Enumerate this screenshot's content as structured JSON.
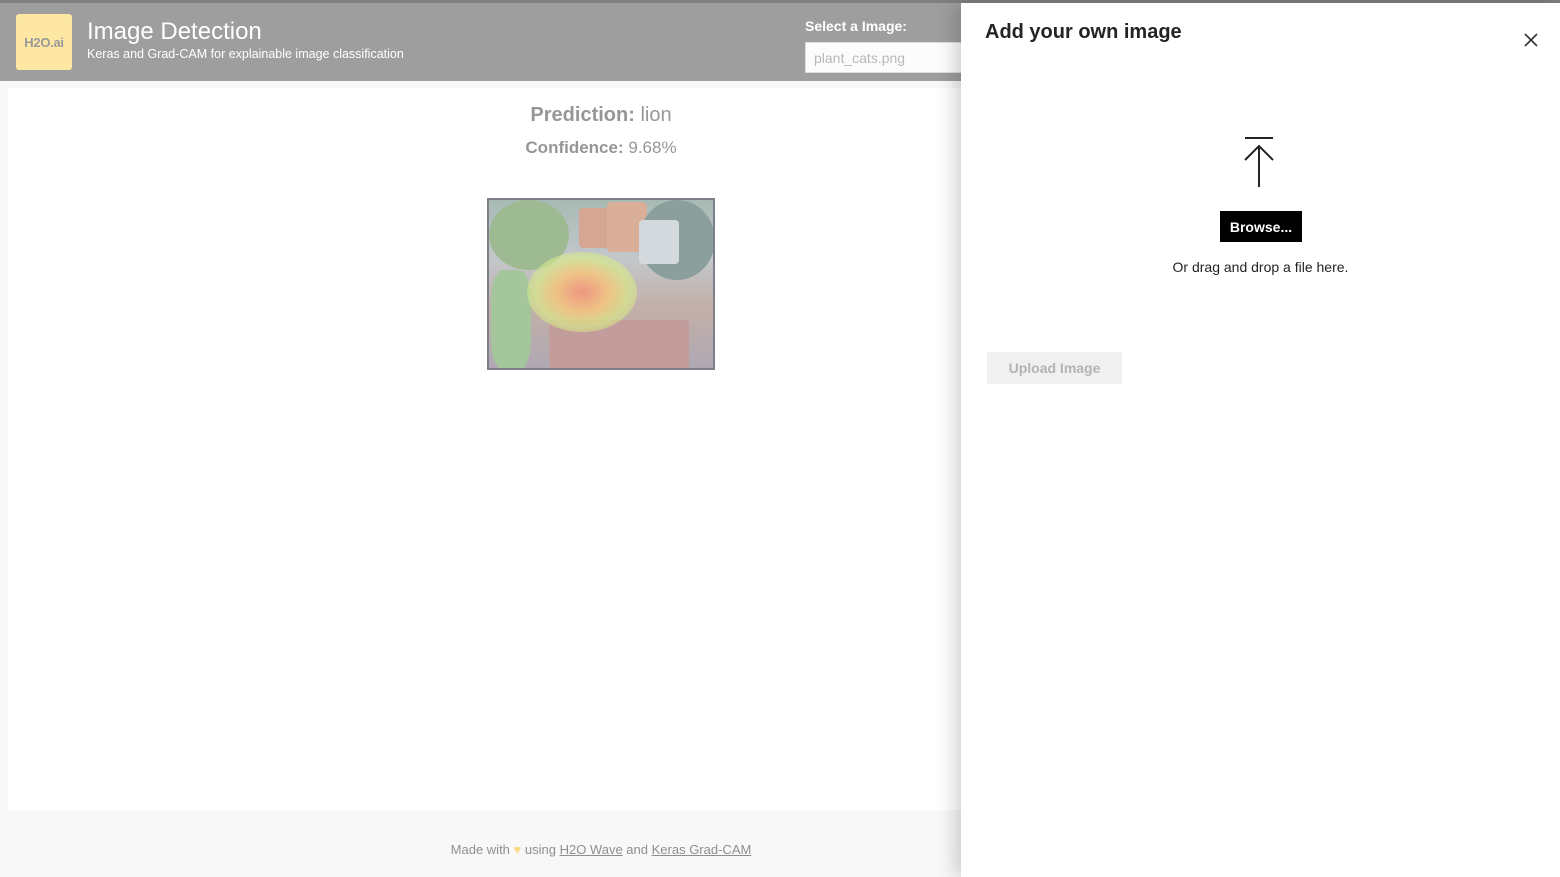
{
  "header": {
    "logo_text": "H2O.ai",
    "title": "Image Detection",
    "subtitle": "Keras and Grad-CAM for explainable image classification",
    "select_label": "Select a Image:",
    "select_value": "plant_cats.png"
  },
  "result": {
    "prediction_label": "Prediction:",
    "prediction_value": "lion",
    "confidence_label": "Confidence:",
    "confidence_value": "9.68%"
  },
  "footer": {
    "made_with": "Made with",
    "using": "using",
    "wave_link": "H2O Wave",
    "and": "and",
    "gradcam_link": "Keras Grad-CAM"
  },
  "panel": {
    "title": "Add your own image",
    "browse_label": "Browse...",
    "drag_text": "Or drag and drop a file here.",
    "upload_label": "Upload Image"
  },
  "colors": {
    "header_bg": "#5e5e5e",
    "logo_bg": "#fed766",
    "browse_bg": "#000000",
    "upload_disabled_bg": "#f0f0f0"
  },
  "icons": [
    "upload-arrow-icon",
    "close-icon",
    "heart-icon"
  ]
}
